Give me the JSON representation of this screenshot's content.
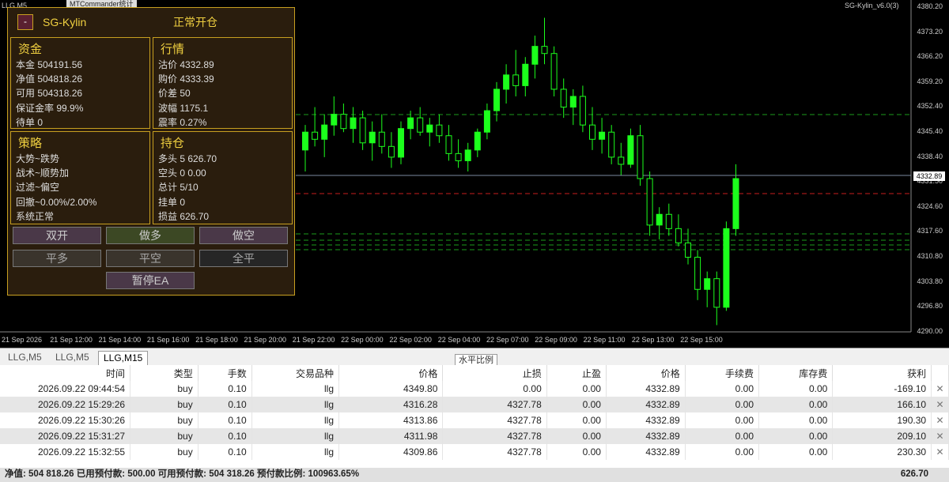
{
  "window_title": "LLG,M5",
  "indicator_label": "MTCommander统计",
  "ea_indicator": "SG-Kylin_v6.0(3)",
  "ea": {
    "min_btn": "-",
    "name": "SG-Kylin",
    "status": "正常开仓",
    "funds": {
      "title": "资金",
      "rows": [
        "本金 504191.56",
        "净值 504818.26",
        "可用 504318.26",
        "保证金率 99.9%",
        "待单 0"
      ]
    },
    "market": {
      "title": "行情",
      "rows": [
        "沽价 4332.89",
        "购价 4333.39",
        "价差 50",
        "波幅 1175.1",
        "震率 0.27%"
      ]
    },
    "strategy": {
      "title": "策略",
      "rows": [
        "大势~跌势",
        "战术~顺势加",
        "过滤~偏空",
        "回撤~0.00%/2.00%",
        "系统正常"
      ]
    },
    "positions": {
      "title": "持仓",
      "rows": [
        "多头 5 626.70",
        "空头 0 0.00",
        "总计 5/10",
        "挂单 0",
        "损益 626.70"
      ]
    },
    "buttons": {
      "both_open": "双开",
      "long_open": "做多",
      "short_open": "做空",
      "close_long": "平多",
      "close_short": "平空",
      "close_all": "全平",
      "pause": "暂停EA"
    }
  },
  "price_axis": [
    "4380.20",
    "4373.20",
    "4366.20",
    "4359.20",
    "4352.40",
    "4345.40",
    "4338.40",
    "4331.50",
    "4324.60",
    "4317.60",
    "4310.80",
    "4303.80",
    "4296.80",
    "4290.00"
  ],
  "current_price_tag": "4332.89",
  "time_axis": [
    "21 Sep 2026",
    "21 Sep 12:00",
    "21 Sep 14:00",
    "21 Sep 16:00",
    "21 Sep 18:00",
    "21 Sep 20:00",
    "21 Sep 22:00",
    "22 Sep 00:00",
    "22 Sep 02:00",
    "22 Sep 04:00",
    "22 Sep 07:00",
    "22 Sep 09:00",
    "22 Sep 11:00",
    "22 Sep 13:00",
    "22 Sep 15:00"
  ],
  "candles": [
    {
      "o": 4340,
      "h": 4347,
      "l": 4334,
      "c": 4345
    },
    {
      "o": 4345,
      "h": 4352,
      "l": 4341,
      "c": 4343
    },
    {
      "o": 4343,
      "h": 4350,
      "l": 4338,
      "c": 4347
    },
    {
      "o": 4347,
      "h": 4355,
      "l": 4344,
      "c": 4350
    },
    {
      "o": 4350,
      "h": 4353,
      "l": 4345,
      "c": 4346
    },
    {
      "o": 4346,
      "h": 4352,
      "l": 4342,
      "c": 4349
    },
    {
      "o": 4349,
      "h": 4351,
      "l": 4340,
      "c": 4342
    },
    {
      "o": 4342,
      "h": 4348,
      "l": 4337,
      "c": 4345
    },
    {
      "o": 4345,
      "h": 4350,
      "l": 4339,
      "c": 4341
    },
    {
      "o": 4341,
      "h": 4345,
      "l": 4335,
      "c": 4338
    },
    {
      "o": 4338,
      "h": 4348,
      "l": 4336,
      "c": 4346
    },
    {
      "o": 4346,
      "h": 4351,
      "l": 4343,
      "c": 4349
    },
    {
      "o": 4349,
      "h": 4352,
      "l": 4344,
      "c": 4345
    },
    {
      "o": 4345,
      "h": 4349,
      "l": 4341,
      "c": 4347
    },
    {
      "o": 4347,
      "h": 4350,
      "l": 4342,
      "c": 4344
    },
    {
      "o": 4344,
      "h": 4347,
      "l": 4337,
      "c": 4339
    },
    {
      "o": 4339,
      "h": 4343,
      "l": 4335,
      "c": 4337
    },
    {
      "o": 4337,
      "h": 4342,
      "l": 4334,
      "c": 4340
    },
    {
      "o": 4340,
      "h": 4346,
      "l": 4338,
      "c": 4345
    },
    {
      "o": 4345,
      "h": 4353,
      "l": 4343,
      "c": 4351
    },
    {
      "o": 4351,
      "h": 4359,
      "l": 4348,
      "c": 4357
    },
    {
      "o": 4357,
      "h": 4364,
      "l": 4353,
      "c": 4361
    },
    {
      "o": 4361,
      "h": 4368,
      "l": 4355,
      "c": 4358
    },
    {
      "o": 4358,
      "h": 4366,
      "l": 4355,
      "c": 4364
    },
    {
      "o": 4364,
      "h": 4372,
      "l": 4360,
      "c": 4369
    },
    {
      "o": 4369,
      "h": 4377,
      "l": 4364,
      "c": 4367
    },
    {
      "o": 4367,
      "h": 4369,
      "l": 4355,
      "c": 4357
    },
    {
      "o": 4357,
      "h": 4360,
      "l": 4349,
      "c": 4352
    },
    {
      "o": 4352,
      "h": 4357,
      "l": 4347,
      "c": 4355
    },
    {
      "o": 4355,
      "h": 4358,
      "l": 4345,
      "c": 4347
    },
    {
      "o": 4347,
      "h": 4352,
      "l": 4340,
      "c": 4343
    },
    {
      "o": 4343,
      "h": 4349,
      "l": 4339,
      "c": 4345
    },
    {
      "o": 4345,
      "h": 4347,
      "l": 4336,
      "c": 4338
    },
    {
      "o": 4338,
      "h": 4342,
      "l": 4333,
      "c": 4336
    },
    {
      "o": 4336,
      "h": 4346,
      "l": 4335,
      "c": 4344
    },
    {
      "o": 4344,
      "h": 4347,
      "l": 4330,
      "c": 4332
    },
    {
      "o": 4332,
      "h": 4334,
      "l": 4316,
      "c": 4319
    },
    {
      "o": 4319,
      "h": 4324,
      "l": 4315,
      "c": 4322
    },
    {
      "o": 4322,
      "h": 4325,
      "l": 4316,
      "c": 4318
    },
    {
      "o": 4318,
      "h": 4322,
      "l": 4313,
      "c": 4314
    },
    {
      "o": 4314,
      "h": 4318,
      "l": 4308,
      "c": 4310
    },
    {
      "o": 4310,
      "h": 4312,
      "l": 4298,
      "c": 4301
    },
    {
      "o": 4301,
      "h": 4306,
      "l": 4296,
      "c": 4304
    },
    {
      "o": 4304,
      "h": 4306,
      "l": 4291,
      "c": 4296
    },
    {
      "o": 4296,
      "h": 4320,
      "l": 4295,
      "c": 4318
    },
    {
      "o": 4318,
      "h": 4336,
      "l": 4316,
      "c": 4332
    }
  ],
  "chart_tabs": [
    "LLG,M5",
    "LLG,M5",
    "LLG,M15"
  ],
  "tooltip": "水平比例",
  "table": {
    "headers": [
      "时间",
      "类型",
      "手数",
      "交易品种",
      "价格",
      "止损",
      "止盈",
      "价格",
      "手续费",
      "库存费",
      "获利",
      ""
    ],
    "rows": [
      [
        "2026.09.22 09:44:54",
        "buy",
        "0.10",
        "llg",
        "4349.80",
        "0.00",
        "0.00",
        "4332.89",
        "0.00",
        "0.00",
        "-169.10",
        "✕"
      ],
      [
        "2026.09.22 15:29:26",
        "buy",
        "0.10",
        "llg",
        "4316.28",
        "4327.78",
        "0.00",
        "4332.89",
        "0.00",
        "0.00",
        "166.10",
        "✕"
      ],
      [
        "2026.09.22 15:30:26",
        "buy",
        "0.10",
        "llg",
        "4313.86",
        "4327.78",
        "0.00",
        "4332.89",
        "0.00",
        "0.00",
        "190.30",
        "✕"
      ],
      [
        "2026.09.22 15:31:27",
        "buy",
        "0.10",
        "llg",
        "4311.98",
        "4327.78",
        "0.00",
        "4332.89",
        "0.00",
        "0.00",
        "209.10",
        "✕"
      ],
      [
        "2026.09.22 15:32:55",
        "buy",
        "0.10",
        "llg",
        "4309.86",
        "4327.78",
        "0.00",
        "4332.89",
        "0.00",
        "0.00",
        "230.30",
        "✕"
      ]
    ]
  },
  "footer": {
    "summary": "净值: 504 818.26  已用预付款: 500.00  可用预付款: 504 318.26  预付款比例: 100963.65%",
    "total": "626.70"
  },
  "colors": {
    "bull": "#1cff1c",
    "bear": "#000000",
    "grid_line": "#1c9c1c",
    "red_line": "#c81e1e",
    "panel_border": "#c8a020",
    "panel_bg": "#2a1d0d"
  }
}
